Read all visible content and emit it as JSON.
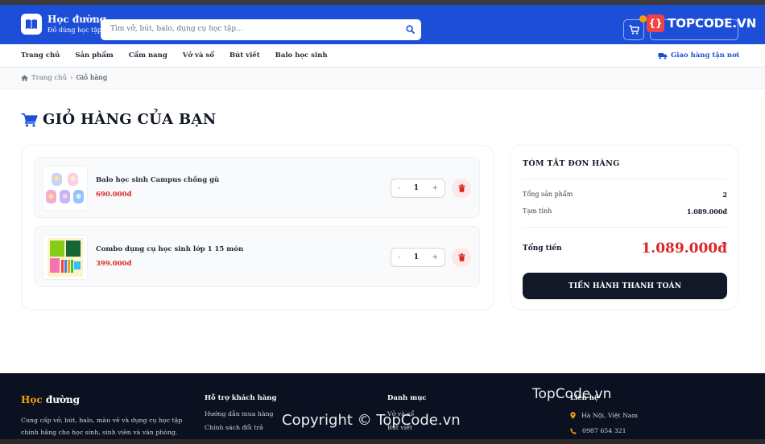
{
  "header": {
    "brand_name": "Học đường",
    "brand_tagline": "Đồ dùng học tập",
    "search_placeholder": "Tìm vở, bút, balo, dụng cụ học tập..."
  },
  "watermark": {
    "logo_text": "TOPCODE.VN",
    "footer_text": "TopCode.vn",
    "copyright": "Copyright © TopCode.vn"
  },
  "nav": {
    "items": [
      "Trang chủ",
      "Sản phẩm",
      "Cẩm nang",
      "Vở và sổ",
      "Bút viết",
      "Balo học sinh"
    ],
    "shipping": "Giao hàng tận nơi"
  },
  "breadcrumb": {
    "home": "Trang chủ",
    "current": "Giỏ hàng"
  },
  "page": {
    "title": "GIỎ HÀNG CỦA BẠN"
  },
  "cart": {
    "items": [
      {
        "name": "Balo học sinh Campus chống gù",
        "price": "690.000đ",
        "qty": "1"
      },
      {
        "name": "Combo dụng cụ học sinh lớp 1 15 món",
        "price": "399.000đ",
        "qty": "1"
      }
    ],
    "minus": "-",
    "plus": "+"
  },
  "summary": {
    "title": "TÓM TẮT ĐƠN HÀNG",
    "count_label": "Tổng sản phẩm",
    "count_value": "2",
    "subtotal_label": "Tạm tính",
    "subtotal_value": "1.089.000đ",
    "total_label": "Tổng tiền",
    "total_value": "1.089.000đ",
    "checkout": "TIẾN HÀNH THANH TOÁN"
  },
  "footer": {
    "brand_hi": "Học",
    "brand_rest": " đường",
    "description": "Cung cấp vở, bút, balo, màu vẽ và dụng cụ học tập chính hãng cho học sinh, sinh viên và văn phòng.",
    "support_title": "Hỗ trợ khách hàng",
    "support_links": [
      "Hướng dẫn mua hàng",
      "Chính sách đổi trả"
    ],
    "category_title": "Danh mục",
    "category_links": [
      "Vở và sổ",
      "Bút viết"
    ],
    "contact_title": "Liên hệ",
    "address": "Hà Nội, Việt Nam",
    "phone": "0987 654 321"
  },
  "colors": {
    "primary": "#1d4ed8",
    "price": "#dc2626",
    "dark": "#111827",
    "accent": "#f59e0b"
  },
  "icons": {
    "logo": "book-icon",
    "search": "search-icon",
    "cart": "cart-icon",
    "truck": "truck-icon",
    "home": "home-icon",
    "trash": "trash-icon",
    "location": "location-icon",
    "phone": "phone-icon"
  }
}
